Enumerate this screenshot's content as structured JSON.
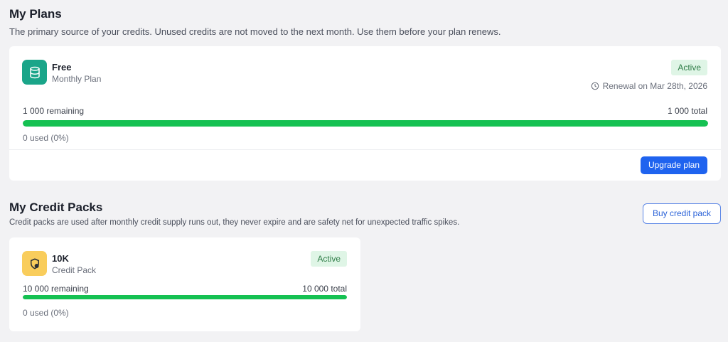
{
  "plans": {
    "title": "My Plans",
    "description": "The primary source of your credits. Unused credits are not moved to the next month. Use them before your plan renews.",
    "card": {
      "icon": "database-icon",
      "icon_color": "#1aa589",
      "name": "Free",
      "subtitle": "Monthly Plan",
      "status": "Active",
      "renewal": "Renewal on Mar 28th, 2026",
      "remaining": "1 000 remaining",
      "total": "1 000 total",
      "used": "0 used (0%)",
      "progress_fraction": 1.0,
      "upgrade_label": "Upgrade plan"
    }
  },
  "credit_packs": {
    "title": "My Credit Packs",
    "description": "Credit packs are used after monthly credit supply runs out, they never expire and are safety net for unexpected traffic spikes.",
    "buy_label": "Buy credit pack",
    "card": {
      "icon": "shield-coin-icon",
      "icon_color": "#f9cd5c",
      "name": "10K",
      "subtitle": "Credit Pack",
      "status": "Active",
      "remaining": "10 000 remaining",
      "total": "10 000 total",
      "used": "0 used (0%)",
      "progress_fraction": 1.0
    }
  },
  "colors": {
    "accent": "#1f63ef",
    "progress": "#15c152",
    "badge_bg": "#dff5e6",
    "badge_text": "#2f7d47"
  }
}
